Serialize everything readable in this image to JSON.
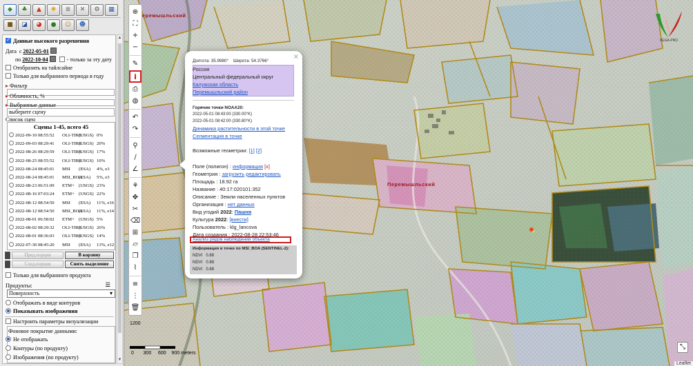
{
  "sidebar": {
    "tab_icons_row1": [
      "layers-icon",
      "tree-icon",
      "fire-icon",
      "sun-icon",
      "layers-stack-icon",
      "tools-icon",
      "gear-icon",
      "table-icon"
    ],
    "tab_icons_row2": [
      "field-icon",
      "satellite-icon",
      "pie-icon",
      "globe-icon",
      "person-icon",
      "users-icon"
    ],
    "high_res_label": "Данные высокого разрешения",
    "date_label": "Дата",
    "date_from_prefix": "с",
    "date_from": "2022-05-01",
    "date_to_prefix": "по",
    "date_to": "2022-10-04",
    "only_this_date": "- только за эту дату",
    "tile_label": "Отобразить на тайлсайне",
    "period_label": "Только для выбранного периода в году",
    "filter_label": "Фильтр",
    "cloud_label": "Облачность, %",
    "selected_label": "Выбранные данные",
    "selected_hint": "выберите сцену",
    "scene_list_label": "Список сцен",
    "scenes_title": "Сцены 1-45, всего 45",
    "scenes": [
      {
        "date": "2022-09-10 08:55:52",
        "sat": "OLI-TIRS",
        "prov": "(USGS)",
        "cloud": "0%"
      },
      {
        "date": "2022-09-03 08:29:41",
        "sat": "OLI-TIRS",
        "prov": "(USGS)",
        "cloud": "20%"
      },
      {
        "date": "2022-08-26 08:29:59",
        "sat": "OLI-TIRS",
        "prov": "(USGS)",
        "cloud": "17%"
      },
      {
        "date": "2022-08-25 08:55:52",
        "sat": "OLI-TIRS",
        "prov": "(USGS)",
        "cloud": "10%"
      },
      {
        "date": "2022-08-24 08:45:01",
        "sat": "MSI",
        "prov": "(ESA)",
        "cloud": "4%, e3"
      },
      {
        "date": "2022-08-24 08:45:01",
        "sat": "MSI_BOA",
        "prov": "(ESA)",
        "cloud": "5%, e3"
      },
      {
        "date": "2022-08-23 06:51:09",
        "sat": "ETM+",
        "prov": "(USGS)",
        "cloud": "23%"
      },
      {
        "date": "2022-08-16 07:03:24",
        "sat": "ETM+",
        "prov": "(USGS)",
        "cloud": "22%"
      },
      {
        "date": "2022-08-12 08:54:50",
        "sat": "MSI",
        "prov": "(ESA)",
        "cloud": "11%, e16"
      },
      {
        "date": "2022-08-12 08:54:50",
        "sat": "MSI_BOA",
        "prov": "(ESA)",
        "cloud": "11%, e14"
      },
      {
        "date": "2022-08-01 06:58:02",
        "sat": "ETM+",
        "prov": "(USGS)",
        "cloud": "5%"
      },
      {
        "date": "2022-08-02 08:29:32",
        "sat": "OLI-TIRS",
        "prov": "(USGS)",
        "cloud": "26%"
      },
      {
        "date": "2022-08-01 08:36:03",
        "sat": "OLI-TIRS",
        "prov": "(USGS)",
        "cloud": "14%"
      },
      {
        "date": "2022-07-30 08:45:20",
        "sat": "MSI",
        "prov": "(ESA)",
        "cloud": "13%, e12"
      }
    ],
    "prev_page": "Пред.порция",
    "to_cart": "В корзину",
    "next_page": "След.порция",
    "clear_selection": "Снять выделение",
    "only_selected_product": "Только для выбранного продукта",
    "products_label": "Продукты:",
    "product_value": "Поверхность",
    "show_contours": "Отображать в виде контуров",
    "show_images": "Показывать изображения",
    "viz_params": "Настроить параметры визуализации",
    "bg_cover_label": "Фоновое покрытие данными:",
    "bg_none": "Не отображать",
    "bg_contours": "Контуры (по продукту)",
    "bg_images": "Изображения (по продукту)"
  },
  "toolbar": [
    "globe-icon",
    "fit-extent-icon",
    "zoom-in-icon",
    "zoom-out-icon",
    "ruler-icon",
    "info-icon",
    "print-icon",
    "layers-circle-icon",
    "undo-icon",
    "redo-icon",
    "marker-icon",
    "line-icon",
    "angle-icon",
    "person-walk-icon",
    "move-icon",
    "split-icon",
    "eraser-icon",
    "scissors-icon",
    "paint-icon",
    "copy-icon",
    "chart-icon",
    "list-icon",
    "ruler-vertical-icon",
    "trash-icon"
  ],
  "popup": {
    "lon": "Долгота: 35.9980°",
    "lat": "Широта: 54.3766°",
    "admin": [
      "Россия",
      "Центральный федеральный округ",
      "Калужская область",
      "Перемышльский район"
    ],
    "hot_title": "Горячие точки NOAA20:",
    "hot": [
      "2022-05-01 08:43:00   (330.00°K)",
      "2022-05-01 08:42:00   (330.80°K)"
    ],
    "dyn_link": "Динамика растительности в этой точке",
    "seg_link": "Сегментация в точке",
    "geom_label": "Возможные геометрии:",
    "geom1": "[1]",
    "geom2": "[2]",
    "field_label": "Поле (полигон) :",
    "field_info": "информация",
    "field_x": "[x]",
    "geometry_label": "Геометрия :",
    "geometry_load": "загрузить",
    "geometry_edit": "редактировать",
    "area": "Площадь : 18.92 га",
    "name": "Название : 40:17:020101:352",
    "desc": "Описание : Земли населенных пунктов",
    "org_label": "Организация :",
    "org_value": "нет данных",
    "landuse_label": "Вид угодий",
    "landuse_year": "2022",
    "landuse_value": "Пашня",
    "culture_label": "Культура",
    "culture_year": "2022",
    "culture_value": "[внести]",
    "user": "Пользователь : klg_lancova",
    "created": "Дата создания : 2022-08-28 22:53:46",
    "analysis_link": "Анализ рядов наблюдений объекта",
    "point_info_title": "Информация в точке по MSI_BOA (SENTINEL-2):",
    "ndvi": [
      {
        "label": "NDVI",
        "value": "0.88"
      },
      {
        "label": "NDVI",
        "value": "0.88"
      },
      {
        "label": "NDVI",
        "value": "0.88"
      }
    ]
  },
  "map": {
    "town_label_1": "Перемышльский",
    "town_label_2": "Перемышльский",
    "scale_top": "1200",
    "scale_ticks": [
      "0",
      "300",
      "600",
      "900 meters"
    ],
    "leaflet": "Leaflet",
    "logo_text": "VEGA-PRO"
  }
}
